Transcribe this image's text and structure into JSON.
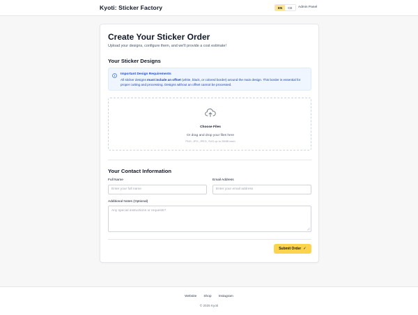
{
  "header": {
    "brand": "Kyoti: Sticker Factory",
    "languages": [
      "EN",
      "CE"
    ],
    "admin_link": "Admin Panel"
  },
  "form": {
    "title": "Create Your Sticker Order",
    "subtitle": "Upload your designs, configure them, and we'll provide a cost estimate!",
    "designs_heading": "Your Sticker Designs",
    "notice": {
      "title": "Important Design Requirements",
      "body_before": "All sticker designs ",
      "body_bold": "must include an offset",
      "body_after": " (white, black, or colored border) around the main design. This border is essential for proper cutting and processing. Designs without an offset cannot be processed."
    },
    "upload": {
      "button": "Choose Files",
      "drag_text": "Or drag and drop your files here",
      "formats": "PNG, JPG, JPEG, SVG up to 25MB each"
    },
    "contact_heading": "Your Contact Information",
    "full_name": {
      "label": "Full Name",
      "placeholder": "Enter your full name"
    },
    "email": {
      "label": "Email Address",
      "placeholder": "Enter your email address"
    },
    "notes": {
      "label": "Additional Notes (Optional)",
      "placeholder": "Any special instructions or requests?"
    },
    "submit": "Submit Order"
  },
  "footer": {
    "links": [
      "Website",
      "Shop",
      "Instagram"
    ],
    "copyright": "© 2025 Kyoti"
  },
  "colors": {
    "accent": "#fcd34d",
    "notice_bg": "#eff6ff",
    "notice_text": "#1d4ed8"
  },
  "icons": {
    "info": "info-circle-icon",
    "upload": "cloud-upload-icon",
    "submit": "check-icon"
  }
}
